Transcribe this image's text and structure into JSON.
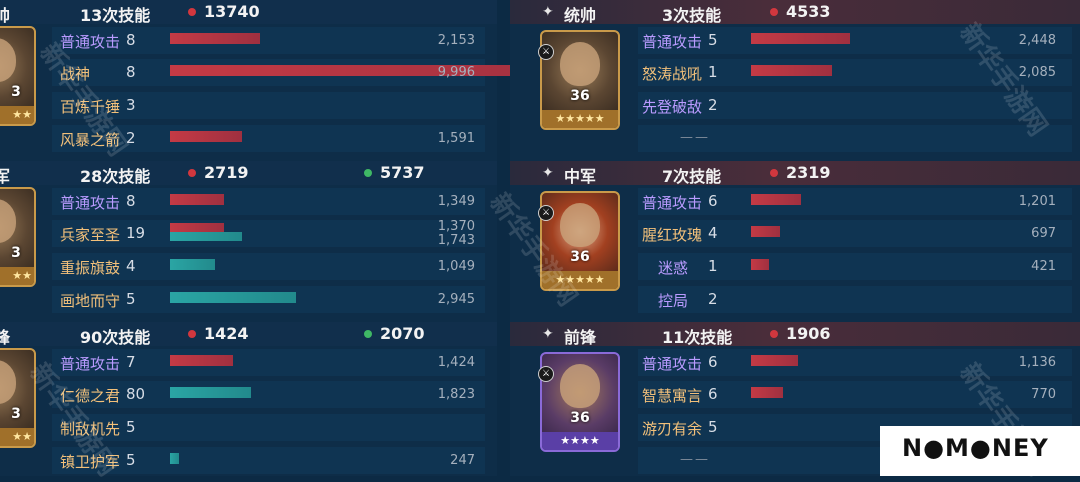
{
  "left": {
    "groups": [
      {
        "role": "帅",
        "skills_label": "13次技能",
        "damage": "13740",
        "heal": "",
        "portrait": {
          "level": "3",
          "stars": "★★"
        },
        "rows": [
          {
            "name": "普通攻击",
            "count": "8",
            "value": "2,153",
            "bar": 0.1,
            "color": "red",
            "style": "purple"
          },
          {
            "name": "战神",
            "count": "8",
            "value": "9,996",
            "bar": 0.48,
            "color": "red",
            "style": "orange"
          },
          {
            "name": "百炼千锤",
            "count": "3",
            "value": "",
            "bar": 0,
            "color": "red",
            "style": "orange"
          },
          {
            "name": "风暴之箭",
            "count": "2",
            "value": "1,591",
            "bar": 0.08,
            "color": "red",
            "style": "orange"
          }
        ]
      },
      {
        "role": "军",
        "skills_label": "28次技能",
        "damage": "2719",
        "heal": "5737",
        "portrait": {
          "level": "3",
          "stars": "★★"
        },
        "rows": [
          {
            "name": "普通攻击",
            "count": "8",
            "value": "1,349",
            "bar": 0.06,
            "color": "red",
            "style": "purple"
          },
          {
            "name": "兵家至圣",
            "count": "19",
            "value": "1,370",
            "value2": "1,743",
            "bar": 0.06,
            "bar2": 0.08,
            "color": "dual",
            "style": "orange"
          },
          {
            "name": "重振旗鼓",
            "count": "4",
            "value": "1,049",
            "bar": 0.05,
            "color": "teal",
            "style": "orange"
          },
          {
            "name": "画地而守",
            "count": "5",
            "value": "2,945",
            "bar": 0.14,
            "color": "teal",
            "style": "orange"
          }
        ]
      },
      {
        "role": "锋",
        "skills_label": "90次技能",
        "damage": "1424",
        "heal": "2070",
        "portrait": {
          "level": "3",
          "stars": "★★"
        },
        "rows": [
          {
            "name": "普通攻击",
            "count": "7",
            "value": "1,424",
            "bar": 0.07,
            "color": "red",
            "style": "purple"
          },
          {
            "name": "仁德之君",
            "count": "80",
            "value": "1,823",
            "bar": 0.09,
            "color": "teal",
            "style": "orange"
          },
          {
            "name": "制敌机先",
            "count": "5",
            "value": "",
            "bar": 0,
            "color": "red",
            "style": "orange"
          },
          {
            "name": "镇卫护军",
            "count": "5",
            "value": "247",
            "bar": 0.01,
            "color": "teal",
            "style": "orange"
          }
        ]
      }
    ]
  },
  "right": {
    "groups": [
      {
        "role": "统帅",
        "skills_label": "3次技能",
        "damage": "4533",
        "portrait": {
          "level": "36",
          "stars": "★★★★★",
          "frame": "gold"
        },
        "rows": [
          {
            "name": "普通攻击",
            "count": "5",
            "value": "2,448",
            "bar": 0.11,
            "color": "red",
            "style": "purple"
          },
          {
            "name": "怒涛战吼",
            "count": "1",
            "value": "2,085",
            "bar": 0.09,
            "color": "red",
            "style": "orange"
          },
          {
            "name": "先登破敌",
            "count": "2",
            "value": "",
            "bar": 0,
            "color": "red",
            "style": "purple"
          },
          {
            "name": "",
            "count": "",
            "value": "",
            "dash": "——",
            "bar": 0,
            "color": "red",
            "style": "orange"
          }
        ]
      },
      {
        "role": "中军",
        "skills_label": "7次技能",
        "damage": "2319",
        "portrait": {
          "level": "36",
          "stars": "★★★★★",
          "frame": "gold"
        },
        "rows": [
          {
            "name": "普通攻击",
            "count": "6",
            "value": "1,201",
            "bar": 0.055,
            "color": "red",
            "style": "purple"
          },
          {
            "name": "腥红玫瑰",
            "count": "4",
            "value": "697",
            "bar": 0.032,
            "color": "red",
            "style": "orange"
          },
          {
            "name": "迷惑",
            "count": "1",
            "value": "421",
            "bar": 0.02,
            "color": "red",
            "style": "purple"
          },
          {
            "name": "控局",
            "count": "2",
            "value": "",
            "bar": 0,
            "color": "red",
            "style": "purple"
          }
        ]
      },
      {
        "role": "前锋",
        "skills_label": "11次技能",
        "damage": "1906",
        "portrait": {
          "level": "36",
          "stars": "★★★★",
          "frame": "purple"
        },
        "rows": [
          {
            "name": "普通攻击",
            "count": "6",
            "value": "1,136",
            "bar": 0.052,
            "color": "red",
            "style": "purple"
          },
          {
            "name": "智慧寓言",
            "count": "6",
            "value": "770",
            "bar": 0.035,
            "color": "red",
            "style": "orange"
          },
          {
            "name": "游刃有余",
            "count": "5",
            "value": "",
            "bar": 0,
            "color": "red",
            "style": "orange"
          },
          {
            "name": "",
            "count": "",
            "value": "",
            "dash": "——",
            "bar": 0,
            "color": "red",
            "style": "orange"
          }
        ]
      }
    ]
  },
  "watermark": "新华手游网",
  "logo": "N●M●NEY",
  "colors": {
    "damage_dot": "#d2373e",
    "heal_dot": "#3fb865",
    "bar_red": "#c43a45",
    "bar_teal": "#2aa5a4",
    "skill_purple": "#b99bff",
    "skill_orange": "#f2c07a"
  }
}
